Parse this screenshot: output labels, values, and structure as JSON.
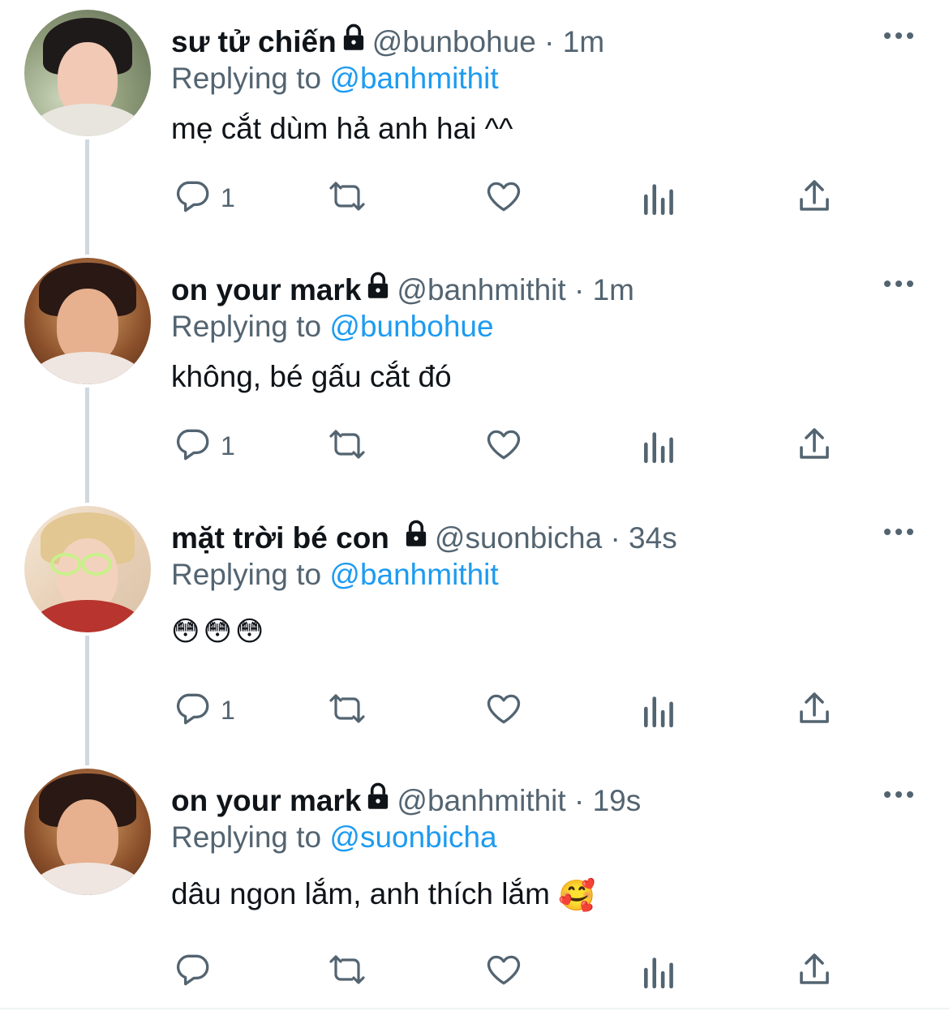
{
  "tweets": [
    {
      "name": "sư tử chiến",
      "handle": "@bunbohue",
      "dot": "·",
      "time": "1m",
      "replying_prefix": "Replying to",
      "replying_to": "@banhmithit",
      "text": "mẹ cắt dùm hả anh hai ^^",
      "reply_count": "1",
      "protected": true
    },
    {
      "name": "on your mark",
      "handle": "@banhmithit",
      "dot": "·",
      "time": "1m",
      "replying_prefix": "Replying to",
      "replying_to": "@bunbohue",
      "text": "không, bé gấu cắt đó",
      "reply_count": "1",
      "protected": true
    },
    {
      "name": "mặt trời bé con",
      "handle": "@suonbicha",
      "dot": "·",
      "time": "34s",
      "replying_prefix": "Replying to",
      "replying_to": "@banhmithit",
      "text": "😳😳😳",
      "reply_count": "1",
      "protected": true
    },
    {
      "name": "on your mark",
      "handle": "@banhmithit",
      "dot": "·",
      "time": "19s",
      "replying_prefix": "Replying to",
      "replying_to": "@suonbicha",
      "text": "dâu ngon lắm, anh thích lắm",
      "text_emoji": "🥰",
      "reply_count": "",
      "protected": true
    }
  ],
  "icons": {
    "reply": "reply-icon",
    "retweet": "retweet-icon",
    "like": "heart-icon",
    "views": "analytics-icon",
    "share": "share-icon",
    "more": "more-icon",
    "lock": "lock-icon"
  },
  "colors": {
    "text": "#0f1419",
    "secondary": "#536471",
    "link": "#1d9bf0",
    "thread_line": "#cfd9de"
  }
}
